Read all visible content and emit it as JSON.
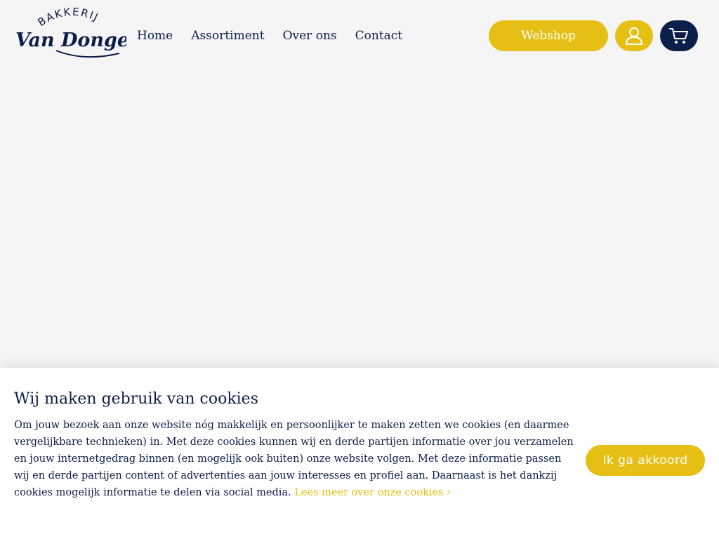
{
  "brand": {
    "top_text": "BAKKERIJ",
    "main_text": "Van Dongen"
  },
  "nav": {
    "items": [
      {
        "label": "Home"
      },
      {
        "label": "Assortiment"
      },
      {
        "label": "Over ons"
      },
      {
        "label": "Contact"
      }
    ]
  },
  "header_actions": {
    "webshop_label": "Webshop",
    "account_icon": "user-icon",
    "cart_icon": "shopping-cart-icon"
  },
  "cookie_banner": {
    "title": "Wij maken gebruik van cookies",
    "body": "Om jouw bezoek aan onze website nóg makkelijk en persoonlijker te maken zetten we cookies (en daarmee vergelijkbare technieken) in. Met deze cookies kunnen wij en derde partijen informatie over jou verzamelen en jouw internetgedrag binnen (en mogelijk ook buiten) onze website volgen. Met deze informatie passen wij en derde partijen content of advertenties aan jouw interesses en profiel aan. Daarnaast is het dankzij cookies mogelijk informatie te delen via social media. ",
    "link_label": "Lees meer over onze cookies ›",
    "accept_label": "Ik ga akkoord"
  },
  "colors": {
    "navy": "#0c1e4a",
    "gold": "#e5bf13",
    "background": "#f6f5f5",
    "banner": "#ffffff"
  }
}
